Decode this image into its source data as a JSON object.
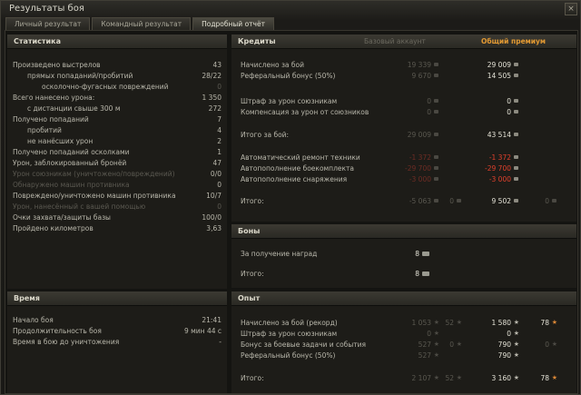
{
  "window": {
    "title": "Результаты боя",
    "close": "×"
  },
  "tabs": [
    "Личный результат",
    "Командный результат",
    "Подробный отчёт"
  ],
  "stats": {
    "title": "Статистика",
    "rows": [
      {
        "label": "Произведено выстрелов",
        "value": "43"
      },
      {
        "label": "прямых попаданий/пробитий",
        "value": "28/22"
      },
      {
        "label": "осколочно-фугасных повреждений",
        "value": "0"
      },
      {
        "label": "Всего нанесено урона:",
        "value": "1 350"
      },
      {
        "label": "с дистанции свыше 300 м",
        "value": "272"
      },
      {
        "label": "Получено попаданий",
        "value": "7"
      },
      {
        "label": "пробитий",
        "value": "4"
      },
      {
        "label": "не нанёсших урон",
        "value": "2"
      },
      {
        "label": "Получено попаданий осколками",
        "value": "1"
      },
      {
        "label": "Урон, заблокированный бронёй",
        "value": "47"
      },
      {
        "label": "Урон союзникам (уничтожено/повреждений)",
        "value": "0/0"
      },
      {
        "label": "Обнаружено машин противника",
        "value": "0"
      },
      {
        "label": "Повреждено/уничтожено машин противника",
        "value": "10/7"
      },
      {
        "label": "Урон, нанесённый с вашей помощью",
        "value": "0"
      },
      {
        "label": "Очки захвата/защиты базы",
        "value": "100/0"
      },
      {
        "label": "Пройдено километров",
        "value": "3,63"
      }
    ]
  },
  "time": {
    "title": "Время",
    "rows": [
      {
        "label": "Начало боя",
        "value": "21:41"
      },
      {
        "label": "Продолжительность боя",
        "value": "9 мин 44 с"
      },
      {
        "label": "Время в бою до уничтожения",
        "value": "-"
      }
    ]
  },
  "credits": {
    "title": "Кредиты",
    "col_base": "Базовый аккаунт",
    "col_premium": "Общий премиум",
    "rows": [
      {
        "label": "Начислено за бой",
        "base": "19 339",
        "prem": "29 009"
      },
      {
        "label": "Реферальный бонус (50%)",
        "base": "9 670",
        "prem": "14 505"
      },
      {
        "label": "Штраф за урон союзникам",
        "base": "0",
        "prem": "0"
      },
      {
        "label": "Компенсация за урон от союзников",
        "base": "0",
        "prem": "0"
      },
      {
        "label": "Итого за бой:",
        "base": "29 009",
        "prem": "43 514"
      },
      {
        "label": "Автоматический ремонт техники",
        "base": "-1 372",
        "prem": "-1 372"
      },
      {
        "label": "Автопополнение боекомплекта",
        "base": "-29 700",
        "prem": "-29 700"
      },
      {
        "label": "Автопополнение снаряжения",
        "base": "-3 000",
        "prem": "-3 000"
      },
      {
        "label": "Итого:",
        "base": "-5 063",
        "base2": "0",
        "prem": "9 502",
        "prem2": "0"
      }
    ]
  },
  "bonds": {
    "title": "Боны",
    "rows": [
      {
        "label": "За получение наград",
        "value": "8"
      },
      {
        "label": "Итого:",
        "value": "8"
      }
    ]
  },
  "xp": {
    "title": "Опыт",
    "rows": [
      {
        "label": "Начислено за бой (рекорд)",
        "b1": "1 053",
        "b2": "52",
        "p1": "1 580",
        "p2": "78"
      },
      {
        "label": "Штраф за урон союзникам",
        "b1": "0",
        "p1": "0"
      },
      {
        "label": "Бонус за боевые задачи и события",
        "b1": "527",
        "b2": "0",
        "p1": "790",
        "p2": "0"
      },
      {
        "label": "Реферальный бонус (50%)",
        "b1": "527",
        "p1": "790"
      },
      {
        "label": "Итого:",
        "b1": "2 107",
        "b2": "52",
        "p1": "3 160",
        "p2": "78"
      }
    ]
  }
}
